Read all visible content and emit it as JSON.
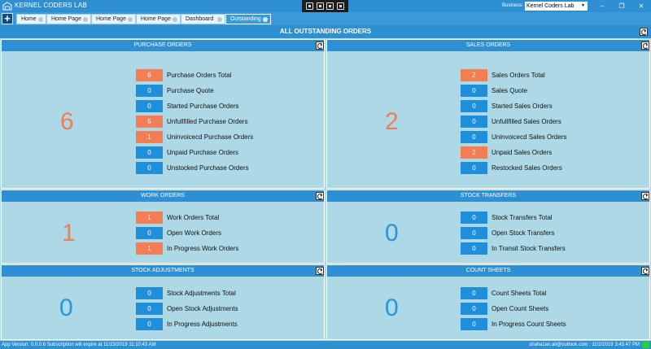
{
  "window": {
    "title": "KERNEL CODERS LAB",
    "business_label": "Business:",
    "business_value": "Kernel Coders Lab",
    "minimize": "–",
    "maximize": "❐",
    "close": "✕"
  },
  "tabs": [
    {
      "label": "Home"
    },
    {
      "label": "Home Page"
    },
    {
      "label": "Home Page"
    },
    {
      "label": "Home Page"
    },
    {
      "label": "Dashboard"
    },
    {
      "label": "Outstanding"
    }
  ],
  "add_button": "+",
  "main_title": "ALL OUTSTANDING ORDERS",
  "panels": {
    "purchase": {
      "title": "PURCHASE ORDERS",
      "total": "6",
      "rows": [
        {
          "value": "6",
          "label": "Purchase Orders Total",
          "color": "#f47d56"
        },
        {
          "value": "0",
          "label": "Purchase Quote",
          "color": "#1f8fdc"
        },
        {
          "value": "0",
          "label": "Started Purchase Orders",
          "color": "#1f8fdc"
        },
        {
          "value": "5",
          "label": "Unfullfilled Purchase Orders",
          "color": "#f47d56"
        },
        {
          "value": "1",
          "label": "Uninvoicecd Purchase Orders",
          "color": "#f47d56"
        },
        {
          "value": "0",
          "label": "Unpaid Purchase Orders",
          "color": "#1f8fdc"
        },
        {
          "value": "0",
          "label": "Unstocked Purchase Orders",
          "color": "#1f8fdc"
        }
      ]
    },
    "sales": {
      "title": "SALES ORDERS",
      "total": "2",
      "rows": [
        {
          "value": "2",
          "label": "Sales Orders Total",
          "color": "#f47d56"
        },
        {
          "value": "0",
          "label": "Sales Quote",
          "color": "#1f8fdc"
        },
        {
          "value": "0",
          "label": "Started Sales Orders",
          "color": "#1f8fdc"
        },
        {
          "value": "0",
          "label": "Unfullfilled Sales Orders",
          "color": "#1f8fdc"
        },
        {
          "value": "0",
          "label": "Uninvoicecd Sales Orders",
          "color": "#1f8fdc"
        },
        {
          "value": "2",
          "label": "Unpaid Sales Orders",
          "color": "#f47d56"
        },
        {
          "value": "0",
          "label": "Restocked Sales Orders",
          "color": "#1f8fdc"
        }
      ]
    },
    "work": {
      "title": "WORK ORDERS",
      "total": "1",
      "rows": [
        {
          "value": "1",
          "label": "Work Orders Total",
          "color": "#f47d56"
        },
        {
          "value": "0",
          "label": "Open Work Orders",
          "color": "#1f8fdc"
        },
        {
          "value": "1",
          "label": "In Progress Work Orders",
          "color": "#f47d56"
        }
      ]
    },
    "transfers": {
      "title": "STOCK TRANSFERS",
      "total": "0",
      "rows": [
        {
          "value": "0",
          "label": "Stock Transfers Total",
          "color": "#1f8fdc"
        },
        {
          "value": "0",
          "label": "Open Stock Transfers",
          "color": "#1f8fdc"
        },
        {
          "value": "0",
          "label": "In Transit Stock Transfers",
          "color": "#1f8fdc"
        }
      ]
    },
    "adjustments": {
      "title": "STOCK ADJUSTMENTS",
      "total": "0",
      "rows": [
        {
          "value": "0",
          "label": "Stock Adjustments Total",
          "color": "#1f8fdc"
        },
        {
          "value": "0",
          "label": "Open Stock Adjustments",
          "color": "#1f8fdc"
        },
        {
          "value": "0",
          "label": "In Progress Adjustments",
          "color": "#1f8fdc"
        }
      ]
    },
    "counts": {
      "title": "COUNT SHEETS",
      "total": "0",
      "rows": [
        {
          "value": "0",
          "label": "Count Sheets Total",
          "color": "#1f8fdc"
        },
        {
          "value": "0",
          "label": "Open Count Sheets",
          "color": "#1f8fdc"
        },
        {
          "value": "0",
          "label": "In Progress Count Sheets",
          "color": "#1f8fdc"
        }
      ]
    }
  },
  "status": {
    "left": "App Version: 0.0.0.6   Subscription will expire at 11/23/2019 11:10:43 AM",
    "right": "shahazan.ali@outlook.com : 11/2/2019 3:45:47 PM"
  },
  "colors": {
    "accent": "#2e8fd3",
    "background": "#add8e6",
    "orange": "#f47d56",
    "blue": "#1f8fdc"
  }
}
